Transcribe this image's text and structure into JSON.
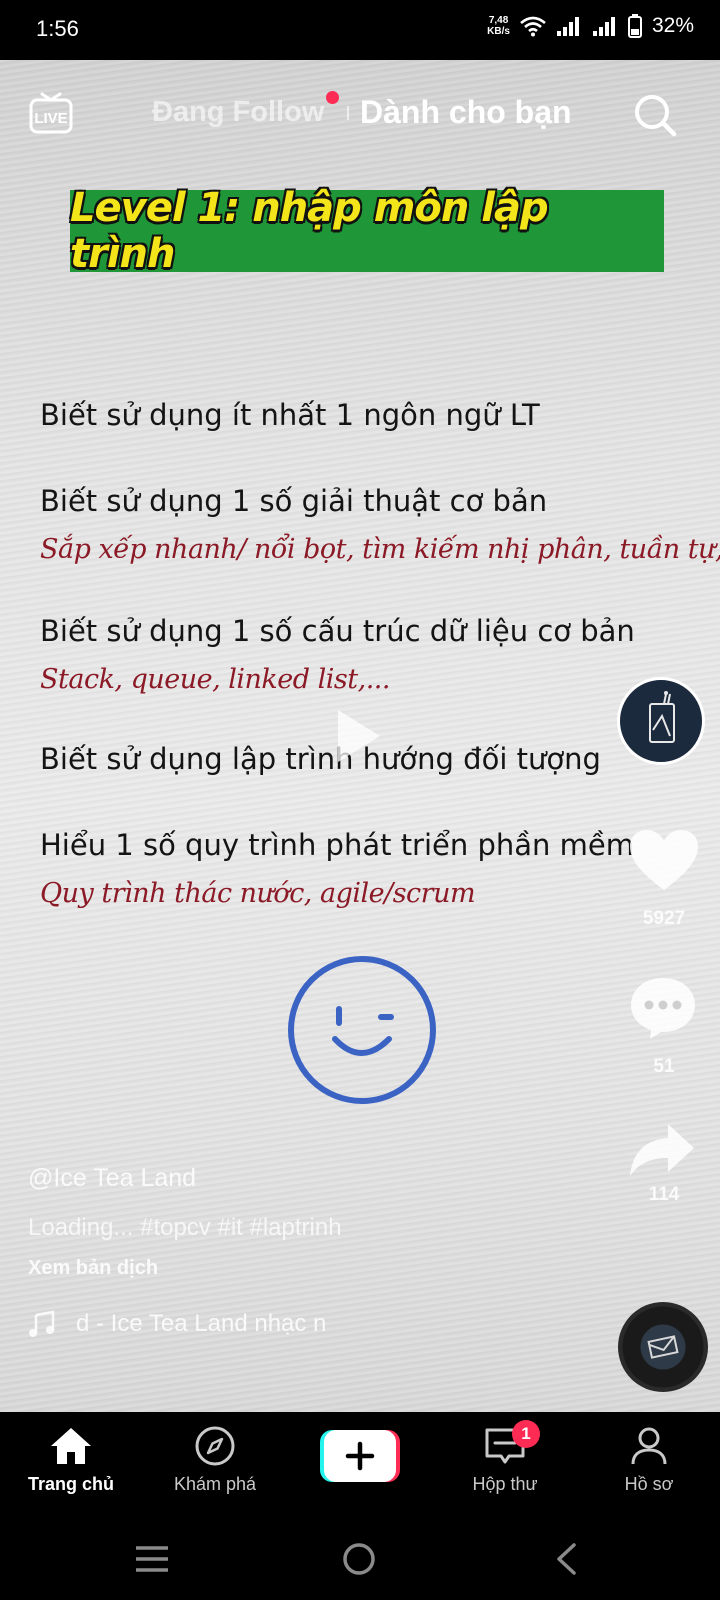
{
  "status_bar": {
    "time": "1:56",
    "net_speed_value": "7,48",
    "net_speed_unit": "KB/s",
    "battery": "32%"
  },
  "top_nav": {
    "live_label": "LIVE",
    "following_tab": "Đang Follow",
    "for_you_tab": "Dành cho bạn"
  },
  "video": {
    "banner": "Level 1: nhập môn lập trình",
    "items": [
      {
        "title": "Biết sử dụng ít nhất 1 ngôn ngữ LT"
      },
      {
        "title": "Biết sử dụng 1 số giải thuật cơ bản",
        "sub": "Sắp xếp nhanh/ nổi bọt, tìm kiếm nhị phân, tuần tự,..."
      },
      {
        "title": "Biết sử dụng 1 số cấu trúc dữ liệu cơ bản",
        "sub": "Stack, queue, linked list,..."
      },
      {
        "title": "Biết sử dụng lập trình hướng đối tượng"
      },
      {
        "title": "Hiểu 1 số quy trình phát triển phần mềm",
        "sub": "Quy trình thác nước, agile/scrum"
      }
    ]
  },
  "actions": {
    "likes": "5927",
    "comments": "51",
    "shares": "114"
  },
  "post": {
    "username": "@Ice Tea Land",
    "caption": "Loading... #topcv #it #laptrinh",
    "translate": "Xem bản dịch",
    "sound": "d - Ice Tea Land    nhạc n"
  },
  "bottom_nav": {
    "home": "Trang chủ",
    "discover": "Khám phá",
    "inbox": "Hộp thư",
    "inbox_badge": "1",
    "profile": "Hồ sơ"
  },
  "colors": {
    "accent": "#fe2c55",
    "banner_bg": "#1f9638",
    "banner_text": "#f3e51a",
    "subtitle": "#8b1a26",
    "loader": "#3b63c4"
  }
}
